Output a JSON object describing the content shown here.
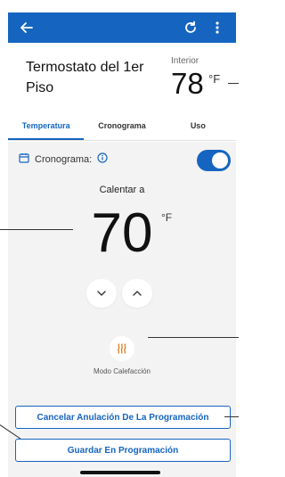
{
  "appbar": {
    "back_icon": "arrow-left-icon",
    "refresh_icon": "refresh-icon",
    "menu_icon": "more-vert-icon",
    "color": "#1565c0"
  },
  "device": {
    "name": "Termostato del 1er Piso",
    "indoor_label": "Interior",
    "indoor_temp": "78",
    "indoor_unit": "°F"
  },
  "tabs": [
    {
      "label": "Temperatura",
      "active": true
    },
    {
      "label": "Cronograma",
      "active": false
    },
    {
      "label": "Uso",
      "active": false
    }
  ],
  "schedule": {
    "label": "Cronograma:",
    "calendar_icon": "calendar-icon",
    "info_icon": "info-icon",
    "toggle_on": true
  },
  "setpoint": {
    "heat_to_label": "Calentar a",
    "value": "70",
    "unit": "°F"
  },
  "mode": {
    "icon": "heat-icon",
    "label": "Modo Calefacción",
    "icon_color": "#e07b1a"
  },
  "actions": {
    "cancel_label": "Cancelar Anulación De La Programación",
    "save_label": "Guardar En Programación"
  }
}
